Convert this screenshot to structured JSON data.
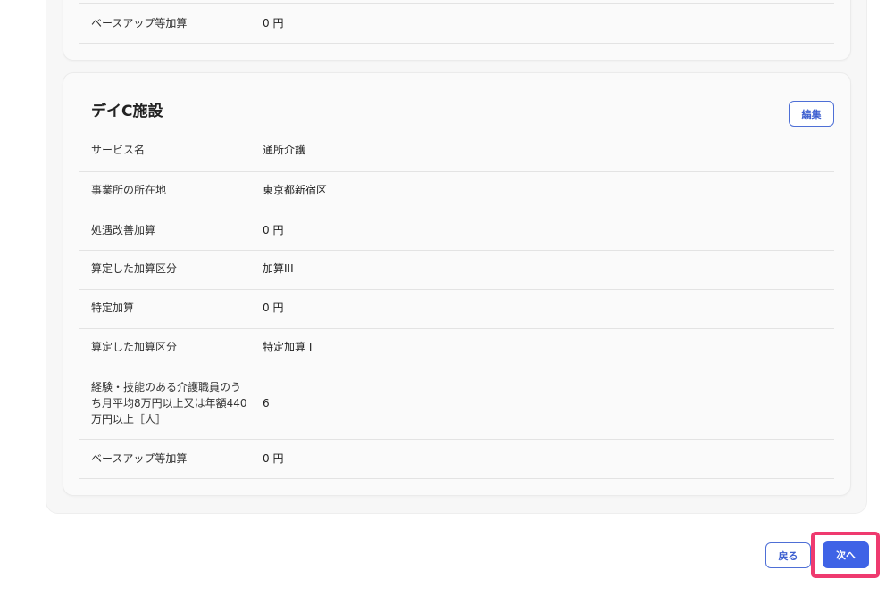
{
  "top_card": {
    "rows": [
      {
        "label": "ベースアップ等加算",
        "value": "0 円"
      }
    ]
  },
  "facility": {
    "title": "デイC施設",
    "edit_label": "編集",
    "rows": [
      {
        "label": "サービス名",
        "value": "通所介護"
      },
      {
        "label": "事業所の所在地",
        "value": "東京都新宿区"
      },
      {
        "label": "処遇改善加算",
        "value": "0 円"
      },
      {
        "label": "算定した加算区分",
        "value": "加算III"
      },
      {
        "label": "特定加算",
        "value": "0 円"
      },
      {
        "label": "算定した加算区分",
        "value": "特定加算 I"
      },
      {
        "label_lines": [
          "経験・技能のある介護職員のう",
          "ち月平均8万円以上又は年額440",
          "万円以上［人］"
        ],
        "value": "6"
      },
      {
        "label": "ベースアップ等加算",
        "value": "0 円"
      }
    ]
  },
  "footer": {
    "back_label": "戻る",
    "next_label": "次へ"
  },
  "colors": {
    "accent": "#3f63e6",
    "highlight": "#ef3a6f"
  }
}
